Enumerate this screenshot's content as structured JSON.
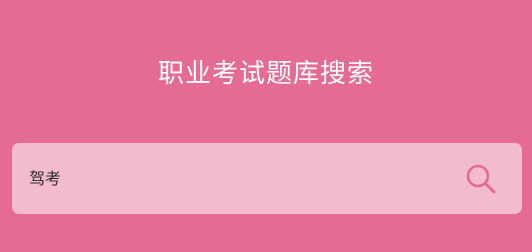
{
  "header": {
    "title": "职业考试题库搜索"
  },
  "search": {
    "value": "驾考",
    "icon": "search-icon"
  },
  "colors": {
    "background": "#e56b93",
    "search_box": "#f2bccd",
    "accent": "#e56b93",
    "title_text": "#ffffff"
  }
}
